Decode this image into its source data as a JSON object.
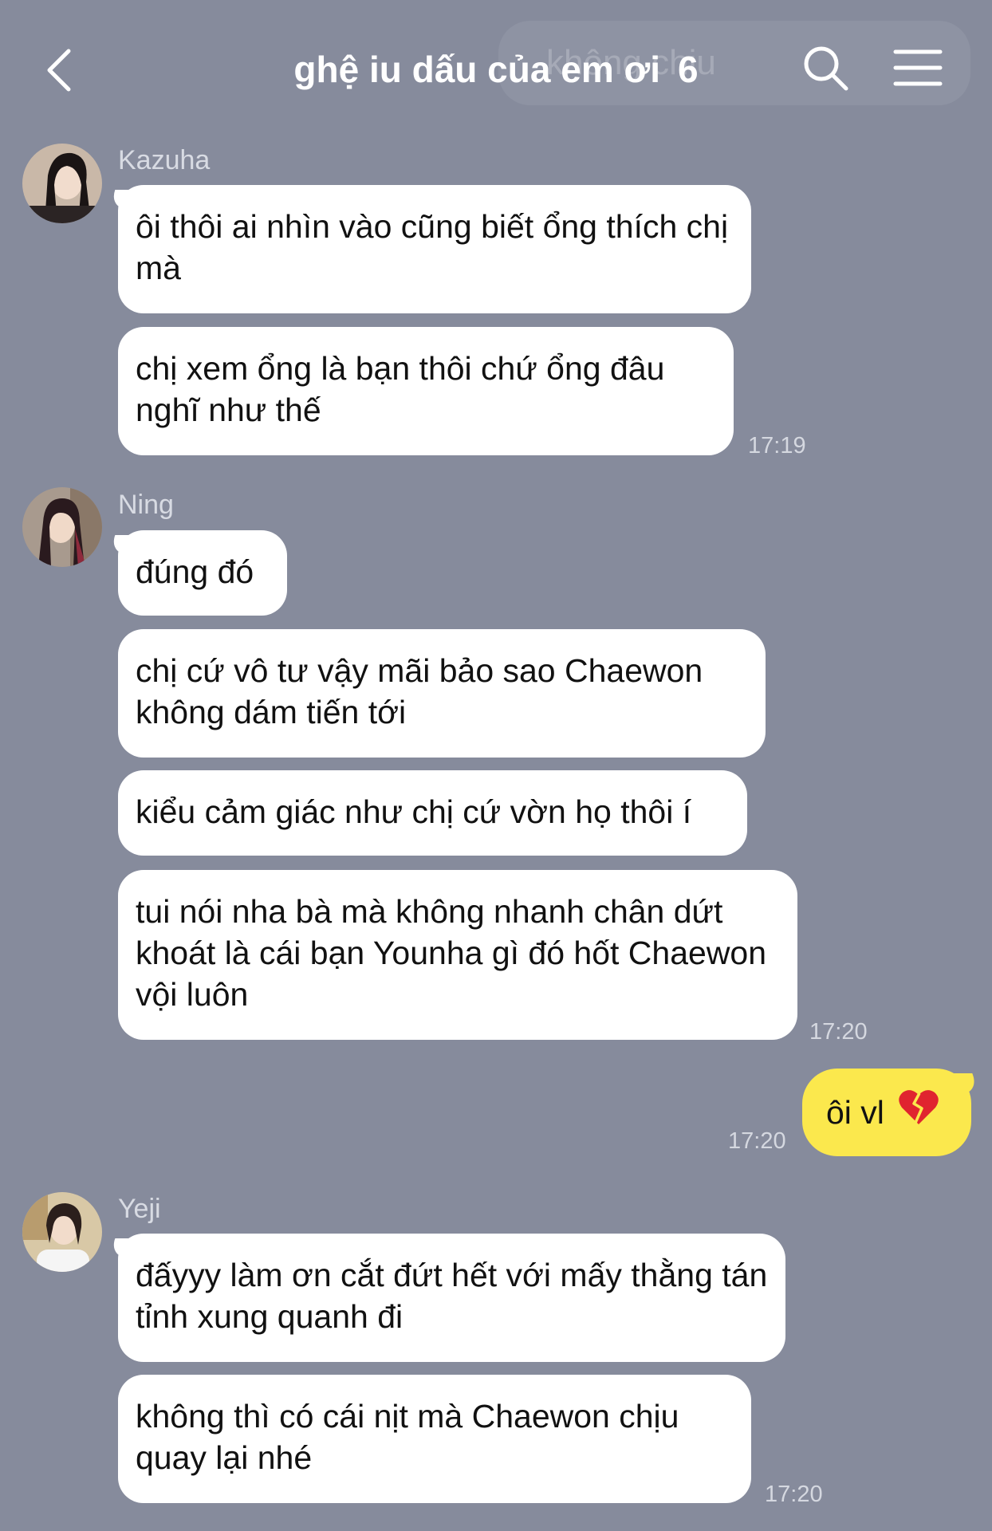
{
  "header": {
    "title": "ghệ iu dấu của em ơi",
    "member_count": "6",
    "search_ghost_text": "không chịu"
  },
  "messages": [
    {
      "sender": "Kazuha",
      "avatar": "avatar-kazuha",
      "bubbles": [
        "ôi thôi ai nhìn vào cũng biết ổng thích chị mà",
        "chị xem ổng là bạn thôi chứ ổng đâu nghĩ như thế"
      ],
      "time": "17:19"
    },
    {
      "sender": "Ning",
      "avatar": "avatar-ning",
      "bubbles": [
        "đúng đó",
        "chị cứ vô tư vậy mãi bảo sao Chaewon không dám tiến tới",
        "kiểu cảm giác như chị cứ vờn họ thôi í",
        "tui nói nha bà mà không nhanh chân dứt khoát là cái bạn Younha gì đó hốt Chaewon vội luôn"
      ],
      "time": "17:20"
    },
    {
      "sender": "me",
      "bubbles": [
        "ôi vl"
      ],
      "emoji_icon": "broken-heart-icon",
      "time": "17:20"
    },
    {
      "sender": "Yeji",
      "avatar": "avatar-yeji",
      "bubbles": [
        "đấyyy làm ơn cắt đứt hết với mấy thằng tán tỉnh xung quanh đi",
        "không thì có cái nịt mà Chaewon chịu quay lại nhé"
      ],
      "time": "17:20"
    }
  ],
  "colors": {
    "background": "#868b9c",
    "my_bubble": "#fbe84d",
    "other_bubble": "#ffffff"
  }
}
